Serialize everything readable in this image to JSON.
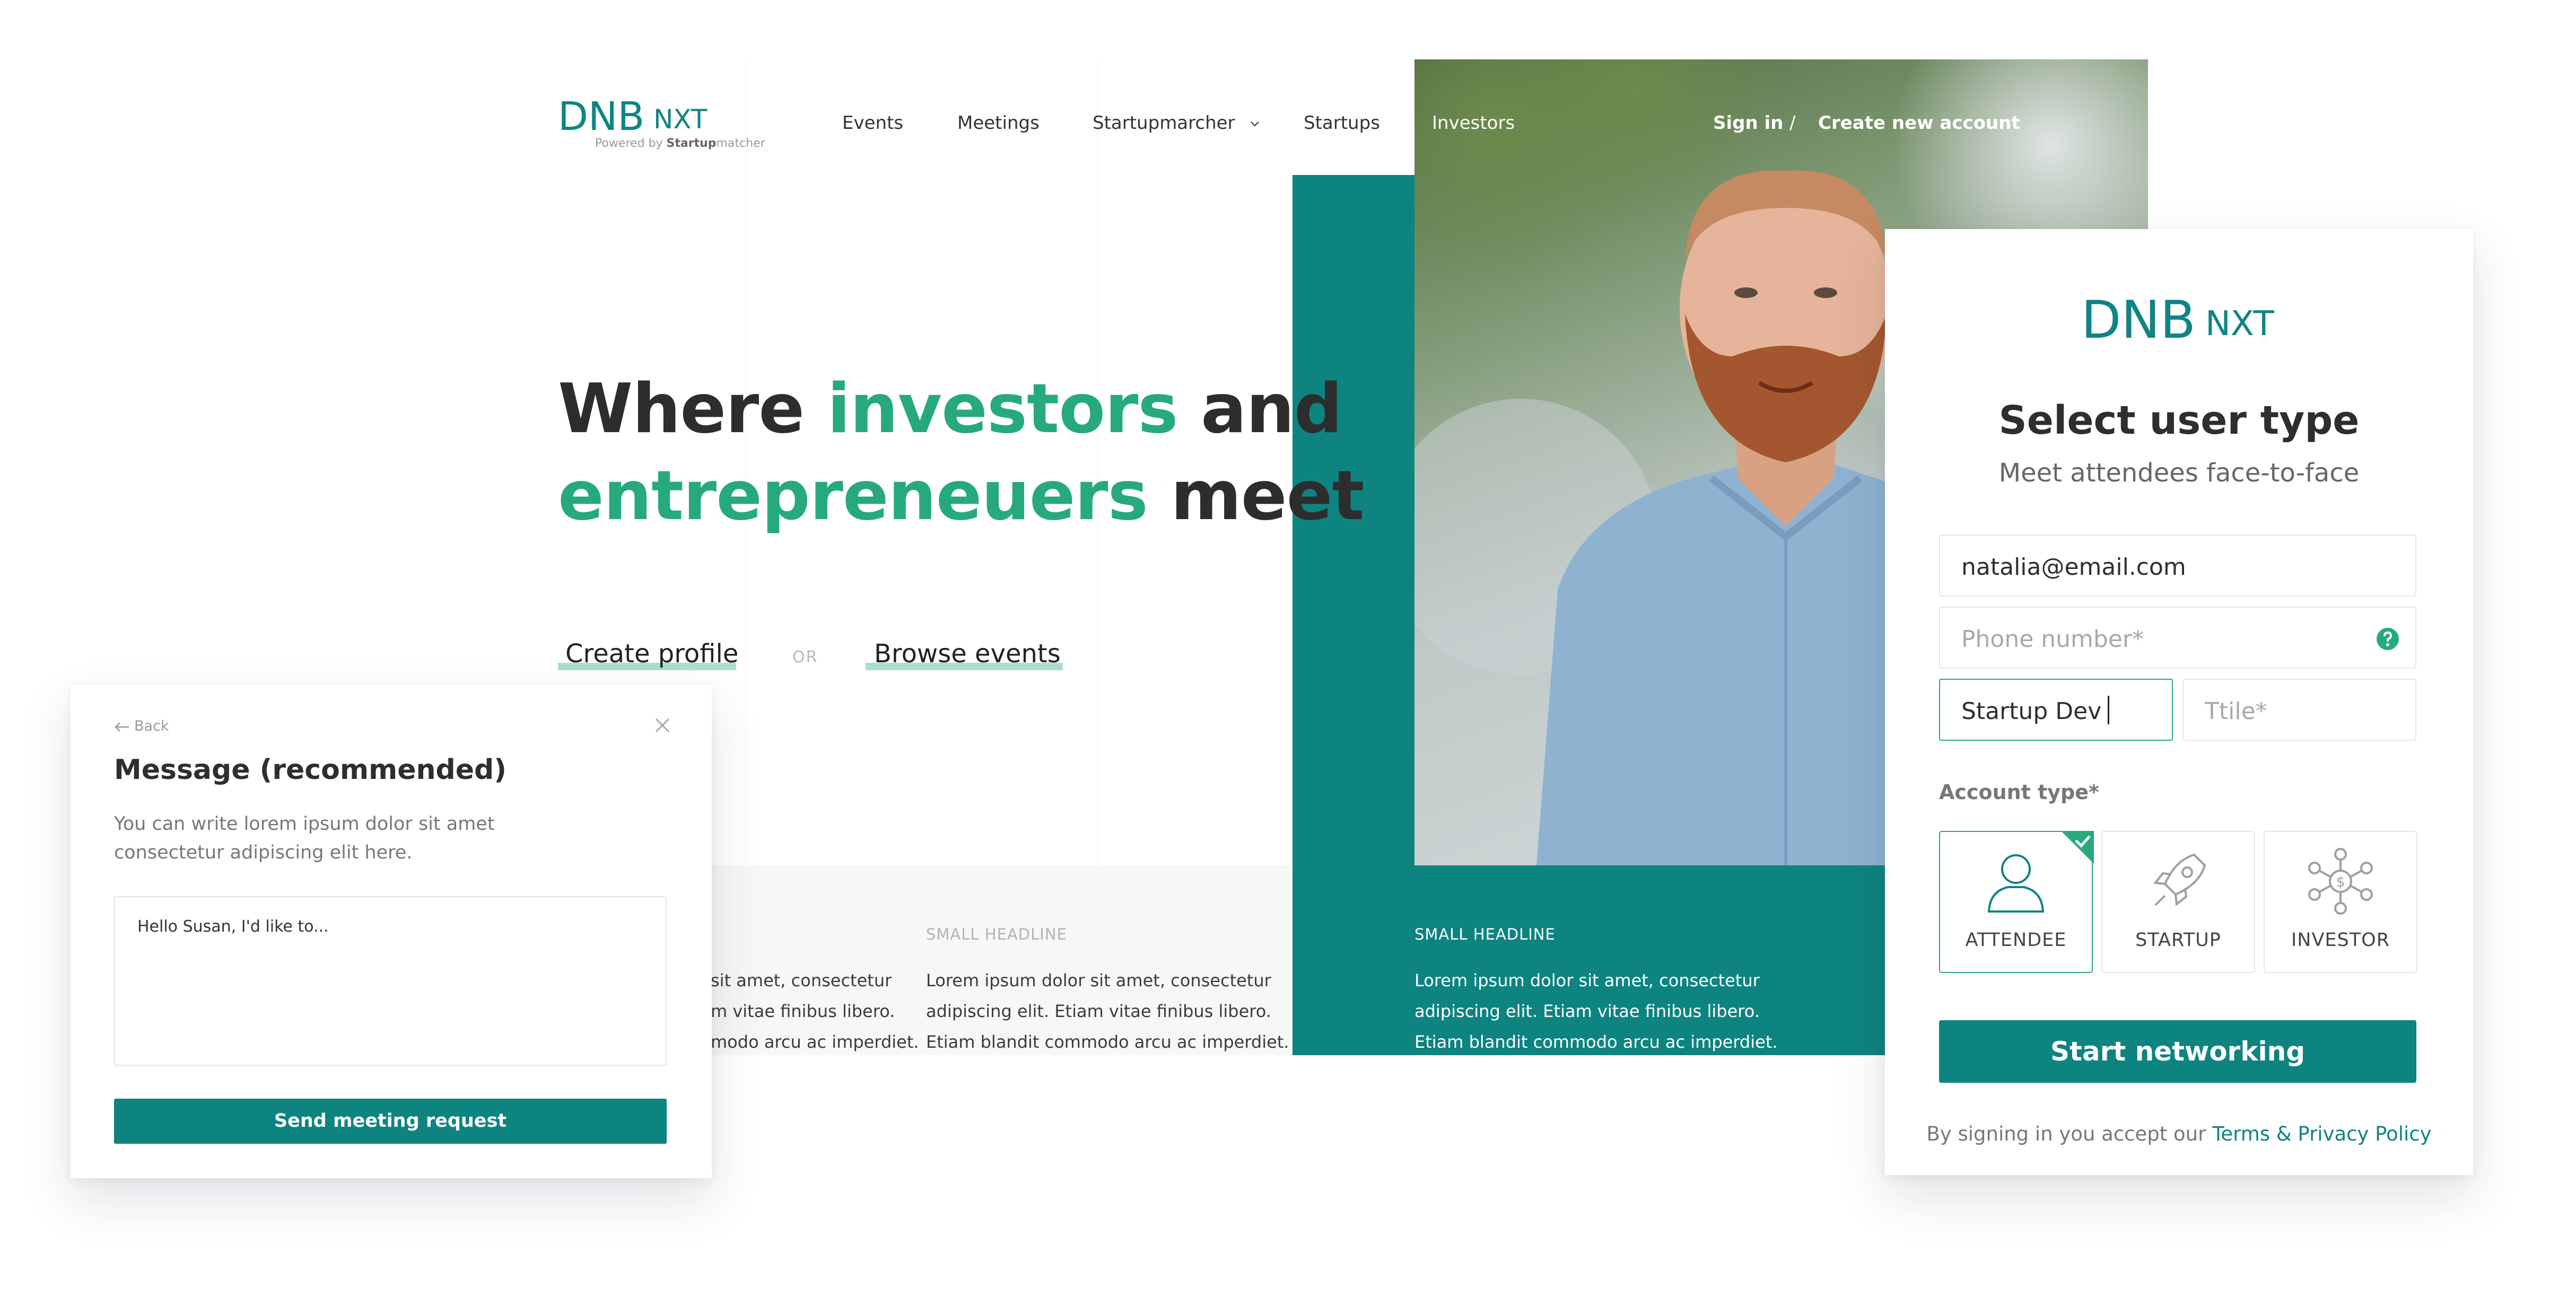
{
  "brand": {
    "name": "DNB",
    "product": "NXT",
    "powered_prefix": "Powered by ",
    "powered_bold": "Startup",
    "powered_suffix": "matcher",
    "teal": "#0d8480",
    "green": "#27a97f"
  },
  "nav": {
    "items": [
      "Events",
      "Meetings",
      "Startupmarcher",
      "Startups",
      "Investors"
    ],
    "sign_in": "Sign in",
    "separator": "/",
    "create_account": "Create new account"
  },
  "hero": {
    "w1": "Where",
    "w2": "investors",
    "w3": "and",
    "w4": "entrepreneuers",
    "w5": "meet",
    "cta_primary": "Create profile",
    "cta_or": "OR",
    "cta_secondary": "Browse events"
  },
  "features": [
    {
      "headline": "",
      "lines": [
        "sit amet, consectetur",
        "m vitae finibus libero.",
        "modo arcu ac imperdiet."
      ]
    },
    {
      "headline": "SMALL HEADLINE",
      "lines": [
        "Lorem ipsum dolor sit amet, consectetur",
        "adipiscing elit. Etiam vitae finibus libero.",
        "Etiam blandit commodo arcu ac imperdiet."
      ]
    },
    {
      "headline": "SMALL HEADLINE",
      "lines": [
        "Lorem ipsum dolor sit amet, consectetur",
        "adipiscing elit. Etiam vitae finibus libero.",
        "Etiam blandit commodo arcu ac imperdiet."
      ]
    }
  ],
  "signup": {
    "title": "Select user type",
    "subtitle": "Meet attendees face-to-face",
    "email_value": "natalia@email.com",
    "phone_placeholder": "Phone number*",
    "company_value": "Startup Dev",
    "title_placeholder": "Ttile*",
    "account_type_label": "Account type*",
    "account_types": [
      "ATTENDEE",
      "STARTUP",
      "INVESTOR"
    ],
    "selected_account": "ATTENDEE",
    "submit": "Start networking",
    "terms_prefix": "By signing in you accept our ",
    "terms_link": "Terms & Privacy Policy"
  },
  "message": {
    "back": "Back",
    "title": "Message (recommended)",
    "desc_line1": "You can write lorem ipsum dolor sit amet",
    "desc_line2": "consectetur adipiscing elit here.",
    "textarea_value": "Hello Susan, I'd like to...",
    "send": "Send meeting request"
  }
}
